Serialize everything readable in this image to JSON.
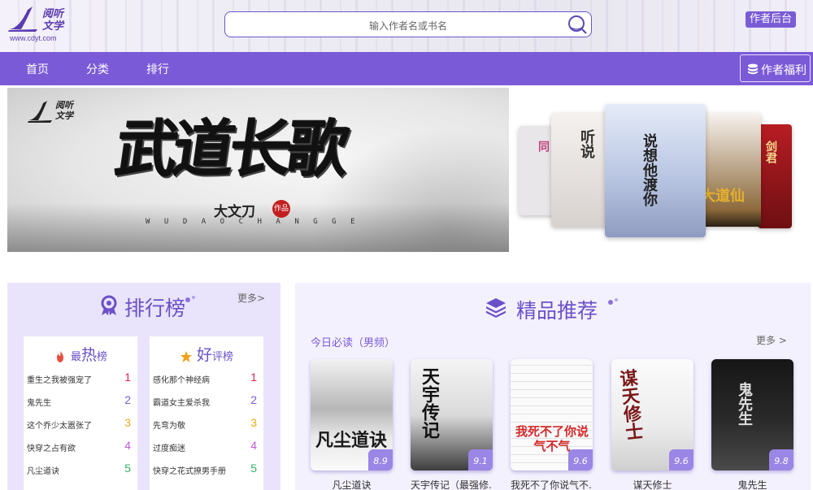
{
  "header": {
    "logo_text": "阅听文学",
    "logo_url": "www.cdyt.com",
    "search_placeholder": "输入作者名或书名",
    "author_backend": "作者后台"
  },
  "nav": {
    "items": [
      "首页",
      "分类",
      "排行"
    ],
    "welfare": "作者福利"
  },
  "banner": {
    "logo_text": "阅听文学",
    "title": "武道长歌",
    "author": "大文刀",
    "seal": "作品",
    "pinyin": "WUDAOCHANGGE"
  },
  "carousel": {
    "books": [
      "同",
      "听说",
      "说想他渡你",
      "大道仙",
      "剑君"
    ]
  },
  "ranking": {
    "title": "排行榜",
    "more": "更多>",
    "hot": {
      "label_big": "热",
      "label_pre": "最",
      "label_post": "榜",
      "items": [
        {
          "name": "重生之我被强宠了",
          "rank": "1"
        },
        {
          "name": "鬼先生",
          "rank": "2"
        },
        {
          "name": "这个乔少太嚣张了",
          "rank": "3"
        },
        {
          "name": "快穿之占有欲",
          "rank": "4"
        },
        {
          "name": "凡尘道诀",
          "rank": "5"
        }
      ]
    },
    "good": {
      "label_big": "好",
      "label_post": "评榜",
      "items": [
        {
          "name": "感化那个神经病",
          "rank": "1"
        },
        {
          "name": "霸道女主爱杀我",
          "rank": "2"
        },
        {
          "name": "先弯为敬",
          "rank": "3"
        },
        {
          "name": "过度痴迷",
          "rank": "4"
        },
        {
          "name": "快穿之花式撩男手册",
          "rank": "5"
        }
      ]
    }
  },
  "recommend": {
    "title": "精品推荐",
    "subtitle": "今日必读（男频）",
    "more": "更多 >",
    "books": [
      {
        "name": "凡尘道诀",
        "score": "8.9",
        "cover_text": "凡尘道诀"
      },
      {
        "name": "天宇传记（最强修...",
        "score": "9.1",
        "cover_text": "天宇传记"
      },
      {
        "name": "我死不了你说气不...",
        "score": "9.6",
        "cover_text": "我死不了你说气不气"
      },
      {
        "name": "谋天修士",
        "score": "9.6",
        "cover_text": "谋天修士"
      },
      {
        "name": "鬼先生",
        "score": "9.8",
        "cover_text": "鬼先生"
      }
    ]
  },
  "colors": {
    "brand": "#7b5ad8",
    "rank_colors": [
      "#e0244e",
      "#7a5cd6",
      "#f2a81d",
      "#c55bd6",
      "#35b36b"
    ]
  }
}
